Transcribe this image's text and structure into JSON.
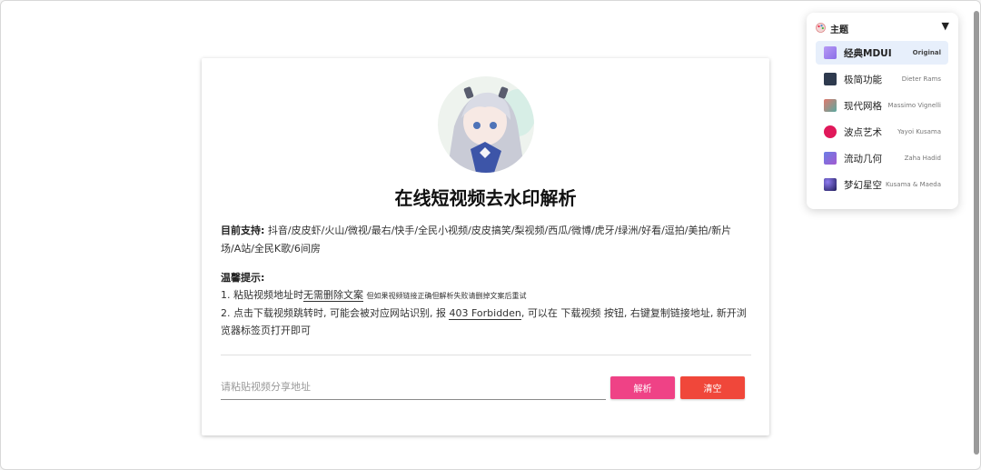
{
  "app": {
    "title": "在线短视频去水印解析"
  },
  "support": {
    "label": "目前支持:",
    "platforms": "抖音/皮皮虾/火山/微视/最右/快手/全民小视频/皮皮搞笑/梨视频/西瓜/微博/虎牙/绿洲/好看/逗拍/美拍/新片场/A站/全民K歌/6间房"
  },
  "tips": {
    "title": "温馨提示:",
    "line1_prefix": "1. 粘贴视频地址时",
    "line1_emphasis": "无需删除文案",
    "line1_note": "但如果视频链接正确但解析失败请删掉文案后重试",
    "line2_prefix": "2. 点击下载视频跳转时, 可能会被对应网站识别, 报",
    "line2_code": "403 Forbidden",
    "line2_suffix": ", 可以在 下载视频 按钮, 右键复制链接地址, 新开浏览器标签页打开即可"
  },
  "form": {
    "placeholder": "请粘贴视频分享地址",
    "value": "",
    "parse_label": "解析",
    "clear_label": "清空"
  },
  "theme": {
    "header": "主题",
    "caret": "▼",
    "items": [
      {
        "name": "经典MDUI",
        "author": "Original",
        "color": "#9b7df0",
        "active": true
      },
      {
        "name": "极简功能",
        "author": "Dieter Rams",
        "color": "#2e3a4e"
      },
      {
        "name": "现代网格",
        "author": "Massimo Vignelli",
        "color": "#e07a6e"
      },
      {
        "name": "波点艺术",
        "author": "Yayoi Kusama",
        "color": "#e0185a"
      },
      {
        "name": "流动几何",
        "author": "Zaha Hadid",
        "color": "#8a5fd6"
      },
      {
        "name": "梦幻星空",
        "author": "Kusama & Maeda",
        "color": "#2f2a7a"
      }
    ]
  }
}
